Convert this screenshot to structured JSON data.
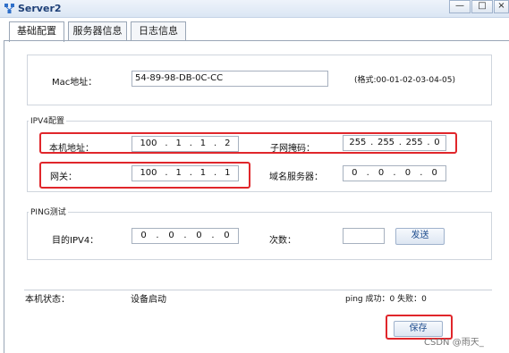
{
  "window": {
    "title": "Server2",
    "minimize": "—",
    "maximize": "□",
    "close": "×"
  },
  "tabs": [
    {
      "label": "基础配置",
      "active": true
    },
    {
      "label": "服务器信息",
      "active": false
    },
    {
      "label": "日志信息",
      "active": false
    }
  ],
  "mac": {
    "label": "Mac地址：",
    "value": "54-89-98-DB-0C-CC",
    "format_hint": "(格式:00-01-02-03-04-05)"
  },
  "ipv4": {
    "section_title": "IPV4配置",
    "local_address_label": "本机地址：",
    "local_address": [
      "100",
      "1",
      "1",
      "2"
    ],
    "subnet_mask_label": "子网掩码：",
    "subnet_mask": [
      "255",
      "255",
      "255",
      "0"
    ],
    "gateway_label": "网关：",
    "gateway": [
      "100",
      "1",
      "1",
      "1"
    ],
    "dns_label": "域名服务器：",
    "dns": [
      "0",
      "0",
      "0",
      "0"
    ]
  },
  "ping": {
    "section_title": "PING测试",
    "target_label": "目的IPV4：",
    "target": [
      "0",
      "0",
      "0",
      "0"
    ],
    "count_label": "次数：",
    "count_value": "",
    "send_button": "发送"
  },
  "status": {
    "state_label": "本机状态：",
    "state_value": "设备启动",
    "ping_result": "ping 成功：0 失败：0"
  },
  "save_button": "保存",
  "watermark": "CSDN @雨天_",
  "colors": {
    "highlight": "#e0262b",
    "title_text": "#1d3f77",
    "button_text": "#1f4d8e"
  }
}
